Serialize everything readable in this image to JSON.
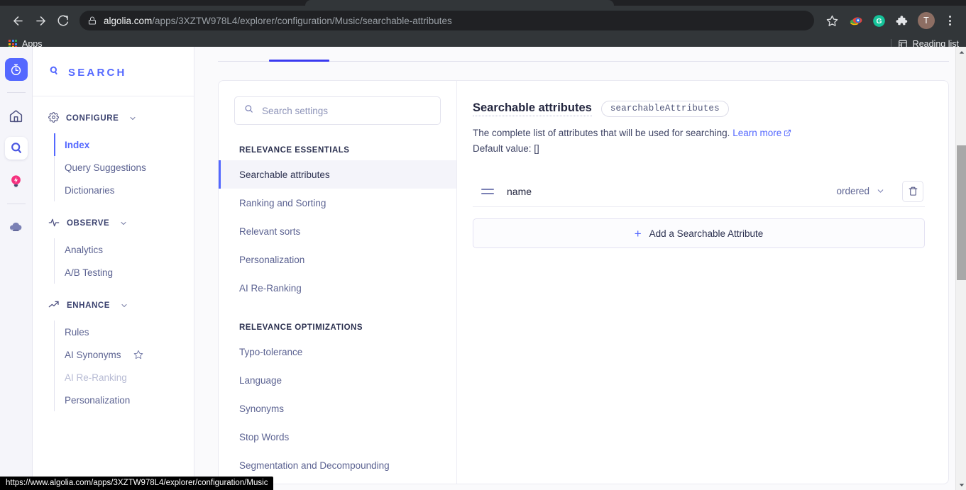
{
  "browser": {
    "url_host": "algolia.com",
    "url_path": "/apps/3XZTW978L4/explorer/configuration/Music/searchable-attributes",
    "back_icon": "back-arrow-icon",
    "forward_icon": "forward-arrow-icon",
    "reload_icon": "reload-icon",
    "lock_icon": "lock-icon",
    "star_icon": "star-icon",
    "avatar_label": "T",
    "bookmarks": {
      "apps_label": "Apps",
      "reading_list_label": "Reading list"
    }
  },
  "status_bar": {
    "url": "https://www.algolia.com/apps/3XZTW978L4/explorer/configuration/Music"
  },
  "icon_rail": {
    "items": [
      {
        "name": "algolia-logo-icon",
        "label": "Algolia"
      },
      {
        "name": "home-icon",
        "label": "Home"
      },
      {
        "name": "search-icon",
        "label": "Search"
      },
      {
        "name": "recommend-bulb-icon",
        "label": "Recommend"
      },
      {
        "name": "cloud-icon",
        "label": "Infrastructure"
      }
    ]
  },
  "sidebar": {
    "brand": "SEARCH",
    "groups": [
      {
        "label": "CONFIGURE",
        "icon": "gear-icon",
        "items": [
          {
            "label": "Index",
            "state": "active"
          },
          {
            "label": "Query Suggestions",
            "state": "normal"
          },
          {
            "label": "Dictionaries",
            "state": "normal"
          }
        ]
      },
      {
        "label": "OBSERVE",
        "icon": "pulse-icon",
        "items": [
          {
            "label": "Analytics",
            "state": "normal"
          },
          {
            "label": "A/B Testing",
            "state": "normal"
          }
        ]
      },
      {
        "label": "ENHANCE",
        "icon": "trending-up-icon",
        "items": [
          {
            "label": "Rules",
            "state": "normal"
          },
          {
            "label": "AI Synonyms",
            "state": "normal",
            "badge_icon": "star-outline-icon"
          },
          {
            "label": "AI Re-Ranking",
            "state": "disabled"
          },
          {
            "label": "Personalization",
            "state": "normal"
          }
        ]
      }
    ]
  },
  "settings_panel": {
    "search_placeholder": "Search settings",
    "search_value": "",
    "search_icon": "search-icon",
    "sections": [
      {
        "label": "RELEVANCE ESSENTIALS",
        "items": [
          {
            "label": "Searchable attributes",
            "state": "active"
          },
          {
            "label": "Ranking and Sorting",
            "state": "normal"
          },
          {
            "label": "Relevant sorts",
            "state": "normal"
          },
          {
            "label": "Personalization",
            "state": "normal"
          },
          {
            "label": "AI Re-Ranking",
            "state": "normal"
          }
        ]
      },
      {
        "label": "RELEVANCE OPTIMIZATIONS",
        "items": [
          {
            "label": "Typo-tolerance",
            "state": "normal"
          },
          {
            "label": "Language",
            "state": "normal"
          },
          {
            "label": "Synonyms",
            "state": "normal"
          },
          {
            "label": "Stop Words",
            "state": "normal"
          },
          {
            "label": "Segmentation and Decompounding",
            "state": "normal"
          }
        ]
      }
    ]
  },
  "detail": {
    "title": "Searchable attributes",
    "badge": "searchableAttributes",
    "description": "The complete list of attributes that will be used for searching.",
    "learn_more": "Learn more",
    "default_value_line": "Default value: []",
    "attributes": [
      {
        "name": "name",
        "mode": "ordered"
      }
    ],
    "add_button": "Add a Searchable Attribute",
    "add_plus": "+",
    "delete_icon": "trash-icon",
    "drag_icon": "drag-handle-icon",
    "chevron_icon": "chevron-down-icon"
  },
  "colors": {
    "accent": "#5468ff",
    "tab_indicator": "#3a3af0",
    "recommend_pink": "#f5317f",
    "chrome_dark": "#323639"
  }
}
